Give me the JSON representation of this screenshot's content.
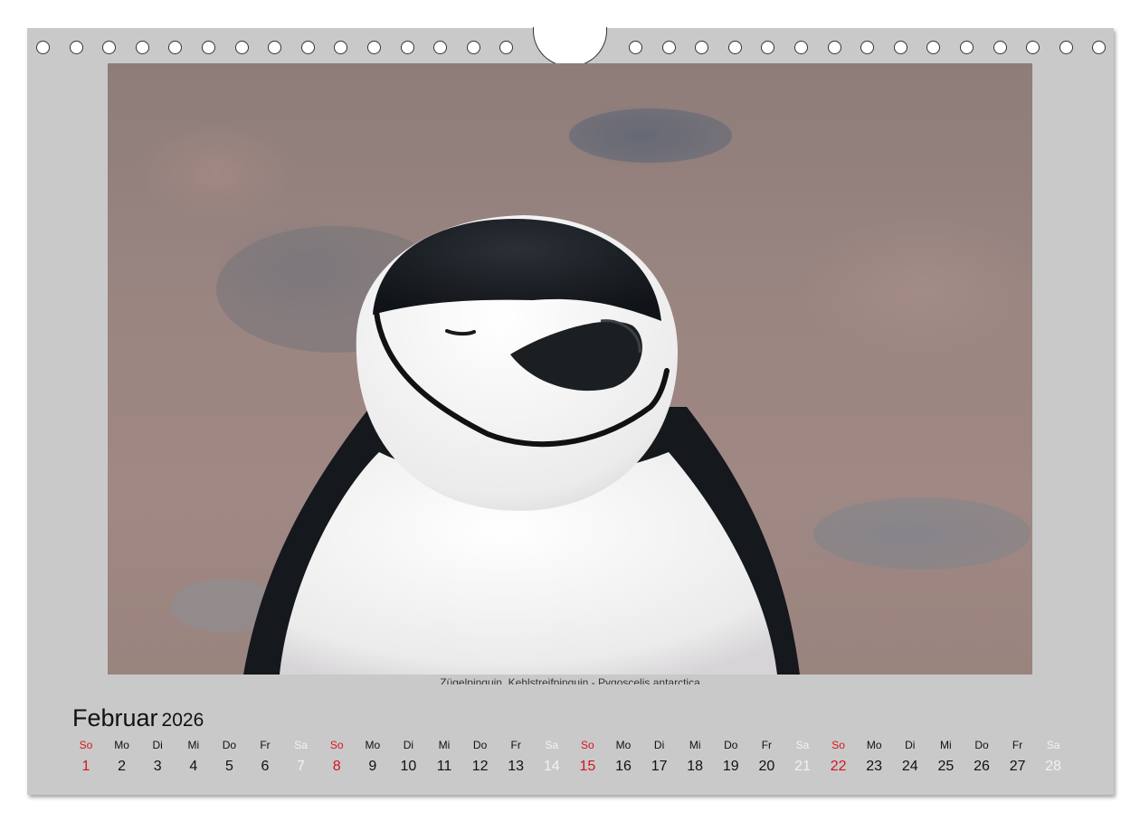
{
  "photo": {
    "caption": "Zügelpinguin, Kehlstreifpinguin - Pygoscelis antarctica"
  },
  "calendar": {
    "month": "Februar",
    "year": "2026",
    "days": [
      {
        "wd": "So",
        "dn": "1",
        "type": "sun"
      },
      {
        "wd": "Mo",
        "dn": "2",
        "type": "work"
      },
      {
        "wd": "Di",
        "dn": "3",
        "type": "work"
      },
      {
        "wd": "Mi",
        "dn": "4",
        "type": "work"
      },
      {
        "wd": "Do",
        "dn": "5",
        "type": "work"
      },
      {
        "wd": "Fr",
        "dn": "6",
        "type": "work"
      },
      {
        "wd": "Sa",
        "dn": "7",
        "type": "sat"
      },
      {
        "wd": "So",
        "dn": "8",
        "type": "sun"
      },
      {
        "wd": "Mo",
        "dn": "9",
        "type": "work"
      },
      {
        "wd": "Di",
        "dn": "10",
        "type": "work"
      },
      {
        "wd": "Mi",
        "dn": "11",
        "type": "work"
      },
      {
        "wd": "Do",
        "dn": "12",
        "type": "work"
      },
      {
        "wd": "Fr",
        "dn": "13",
        "type": "work"
      },
      {
        "wd": "Sa",
        "dn": "14",
        "type": "sat"
      },
      {
        "wd": "So",
        "dn": "15",
        "type": "sun"
      },
      {
        "wd": "Mo",
        "dn": "16",
        "type": "work"
      },
      {
        "wd": "Di",
        "dn": "17",
        "type": "work"
      },
      {
        "wd": "Mi",
        "dn": "18",
        "type": "work"
      },
      {
        "wd": "Do",
        "dn": "19",
        "type": "work"
      },
      {
        "wd": "Fr",
        "dn": "20",
        "type": "work"
      },
      {
        "wd": "Sa",
        "dn": "21",
        "type": "sat"
      },
      {
        "wd": "So",
        "dn": "22",
        "type": "sun"
      },
      {
        "wd": "Mo",
        "dn": "23",
        "type": "work"
      },
      {
        "wd": "Di",
        "dn": "24",
        "type": "work"
      },
      {
        "wd": "Mi",
        "dn": "25",
        "type": "work"
      },
      {
        "wd": "Do",
        "dn": "26",
        "type": "work"
      },
      {
        "wd": "Fr",
        "dn": "27",
        "type": "work"
      },
      {
        "wd": "Sa",
        "dn": "28",
        "type": "sat"
      }
    ]
  },
  "colors": {
    "sheet": "#c9c9c9",
    "sunday": "#d6141e",
    "saturday": "#f2f2f2"
  }
}
